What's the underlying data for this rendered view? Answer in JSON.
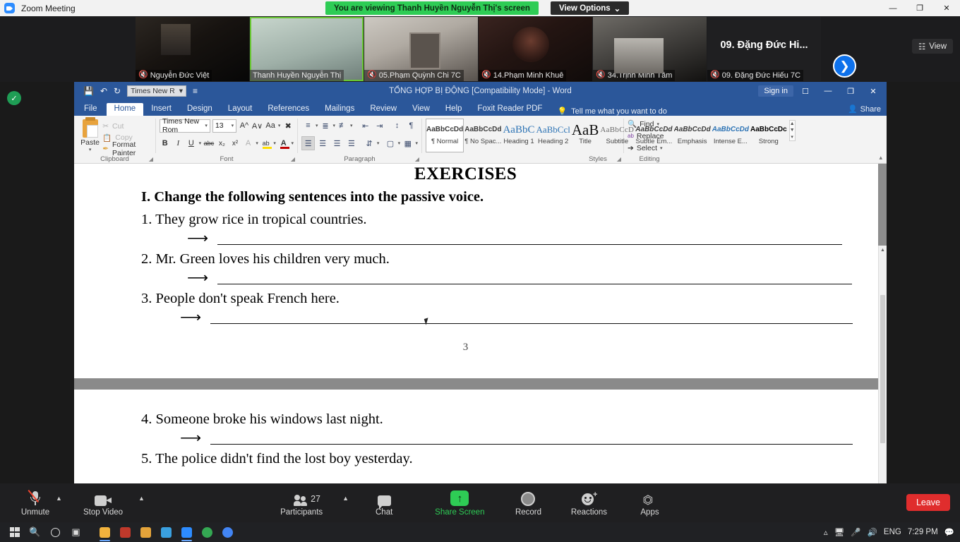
{
  "zoom_titlebar": {
    "app_name": "Zoom Meeting",
    "logo_icon": "zoom-logo-icon",
    "share_banner": "You are viewing Thanh Huyền Nguyễn Thị's screen",
    "view_options": "View Options",
    "view_options_caret": "⌄",
    "minimize": "—",
    "maximize": "❐",
    "close": "✕"
  },
  "filmstrip": {
    "view_button": "View",
    "view_icon": "grid-view-icon",
    "next_page_icon": "chevron-right-icon",
    "thumbnails": [
      {
        "name": "Nguyễn Đức Việt",
        "muted": true,
        "active_speaker": false,
        "video": true
      },
      {
        "name": "Thanh Huyền Nguyễn Thị",
        "muted": false,
        "active_speaker": true,
        "video": true
      },
      {
        "name": "05.Phạm Quỳnh Chi 7C",
        "muted": true,
        "active_speaker": false,
        "video": true
      },
      {
        "name": "14.Phạm Minh Khuê",
        "muted": true,
        "active_speaker": false,
        "video": true
      },
      {
        "name": "34.Trịnh Minh Tâm",
        "muted": true,
        "active_speaker": false,
        "video": true
      },
      {
        "name": "09. Đặng Đức Hiếu 7C",
        "display_name": "09. Đặng Đức Hi...",
        "muted": true,
        "active_speaker": false,
        "video": false
      }
    ]
  },
  "word": {
    "titlebar": {
      "title": "TỔNG HỢP BỊ ĐỘNG [Compatibility Mode]  -  Word",
      "sign_in": "Sign in",
      "save_icon": "save-icon",
      "undo_icon": "undo-icon",
      "redo_icon": "redo-icon",
      "quick_font": "Times New R",
      "customize_qat_icon": "customize-quick-access-icon",
      "ribbon_display_icon": "ribbon-display-options-icon",
      "minimize": "—",
      "restore": "❐",
      "close": "✕"
    },
    "tabs": [
      "File",
      "Home",
      "Insert",
      "Design",
      "Layout",
      "References",
      "Mailings",
      "Review",
      "View",
      "Help",
      "Foxit Reader PDF"
    ],
    "active_tab": "Home",
    "tell_me": "Tell me what you want to do",
    "tell_me_icon": "lightbulb-icon",
    "share": "Share",
    "share_icon": "share-person-icon",
    "ribbon": {
      "clipboard": {
        "label": "Clipboard",
        "paste": "Paste",
        "cut": "Cut",
        "copy": "Copy",
        "format_painter": "Format Painter"
      },
      "font": {
        "label": "Font",
        "font_name": "Times New Rom",
        "font_size": "13",
        "grow_font_icon": "grow-font-icon",
        "shrink_font_icon": "shrink-font-icon",
        "change_case": "Aa",
        "clear_formatting_icon": "clear-formatting-icon",
        "bold": "B",
        "italic": "I",
        "underline": "U",
        "strikethrough": "abc",
        "subscript": "x₂",
        "superscript": "x²",
        "text_effects": "A",
        "highlight": "ab",
        "font_color": "A"
      },
      "paragraph": {
        "label": "Paragraph",
        "bullets_icon": "bullet-list-icon",
        "numbering_icon": "numbered-list-icon",
        "multilevel_icon": "multilevel-list-icon",
        "decrease_indent_icon": "decrease-indent-icon",
        "increase_indent_icon": "increase-indent-icon",
        "sort_icon": "sort-icon",
        "show_marks_icon": "paragraph-mark-icon",
        "align_left_icon": "align-left-icon",
        "align_center_icon": "align-center-icon",
        "align_right_icon": "align-right-icon",
        "justify_icon": "justify-icon",
        "line_spacing_icon": "line-spacing-icon",
        "shading_icon": "shading-icon",
        "borders_icon": "borders-icon"
      },
      "styles": {
        "label": "Styles",
        "items": [
          {
            "preview": "AaBbCcDd",
            "name": "¶ Normal",
            "selected": true
          },
          {
            "preview": "AaBbCcDd",
            "name": "¶ No Spac...",
            "selected": false
          },
          {
            "preview": "AaBbC",
            "name": "Heading 1",
            "selected": false
          },
          {
            "preview": "AaBbCcl",
            "name": "Heading 2",
            "selected": false
          },
          {
            "preview": "AaB",
            "name": "Title",
            "selected": false
          },
          {
            "preview": "AaBbCcD",
            "name": "Subtitle",
            "selected": false
          },
          {
            "preview": "AaBbCcDd",
            "name": "Subtle Em...",
            "selected": false
          },
          {
            "preview": "AaBbCcDd",
            "name": "Emphasis",
            "selected": false
          },
          {
            "preview": "AaBbCcDd",
            "name": "Intense E...",
            "selected": false
          },
          {
            "preview": "AaBbCcDc",
            "name": "Strong",
            "selected": false
          }
        ]
      },
      "editing": {
        "label": "Editing",
        "find": "Find",
        "find_icon": "search-icon",
        "replace": "Replace",
        "replace_icon": "replace-icon",
        "select": "Select",
        "select_icon": "select-pointer-icon"
      }
    },
    "document": {
      "heading": "EXERCISES",
      "instruction": "I. Change the following sentences into the passive voice.",
      "arrow": "⟶",
      "questions_page1": [
        "1. They grow rice in tropical countries.",
        "2. Mr. Green loves his children very much.",
        "3. People don't speak French here."
      ],
      "page_number": "3",
      "questions_page2": [
        "4. Someone broke his windows last night.",
        "5. The police didn't find the lost boy yesterday."
      ]
    }
  },
  "zoom_toolbar": {
    "items": [
      {
        "label": "Unmute",
        "icon": "microphone-muted-icon",
        "caret": true
      },
      {
        "label": "Stop Video",
        "icon": "camera-icon",
        "caret": true
      },
      {
        "label": "Participants",
        "icon": "participants-icon",
        "caret": true,
        "count": "27"
      },
      {
        "label": "Chat",
        "icon": "chat-bubble-icon",
        "caret": false
      },
      {
        "label": "Share Screen",
        "icon": "share-screen-icon",
        "caret": false,
        "highlight": true
      },
      {
        "label": "Record",
        "icon": "record-icon",
        "caret": false
      },
      {
        "label": "Reactions",
        "icon": "reactions-icon",
        "caret": false
      },
      {
        "label": "Apps",
        "icon": "apps-icon",
        "caret": false
      }
    ],
    "leave": "Leave"
  },
  "taskbar": {
    "start_icon": "windows-start-icon",
    "search_icon": "search-icon",
    "cortana_icon": "cortana-circle-icon",
    "taskview_icon": "task-view-icon",
    "apps": [
      "file-explorer-icon",
      "lock-app-icon",
      "folder-icon",
      "browser-icon",
      "zoom-app-icon",
      "chrome-icon",
      "chrome-icon-2"
    ],
    "tray": {
      "expand_icon": "show-hidden-icons-icon",
      "network_icon": "network-icon",
      "mic_icon": "microphone-icon",
      "volume_icon": "volume-icon",
      "language": "ENG",
      "time": "7:29 PM",
      "notification_icon": "notifications-icon"
    }
  },
  "security_badge_icon": "security-shield-icon"
}
